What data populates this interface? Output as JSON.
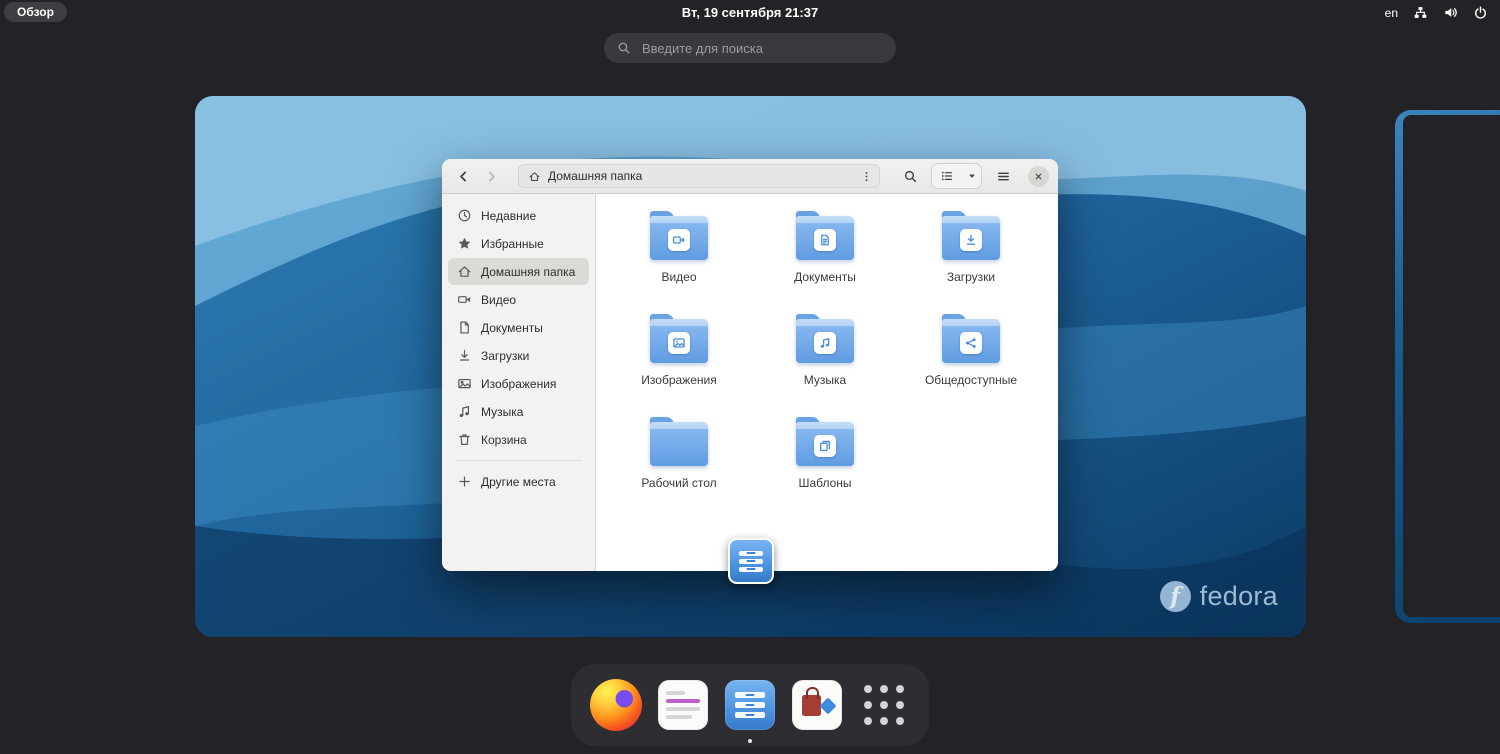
{
  "topbar": {
    "overview_label": "Обзор",
    "clock": "Вт, 19 сентября  21:37",
    "keyboard_layout": "en",
    "status_icons": [
      "network-icon",
      "volume-icon",
      "power-icon"
    ]
  },
  "search": {
    "placeholder": "Введите для поиска"
  },
  "window": {
    "pathbar_location": "Домашняя папка",
    "sidebar": [
      {
        "label": "Недавние",
        "icon": "recent-icon"
      },
      {
        "label": "Избранные",
        "icon": "starred-icon"
      },
      {
        "label": "Домашняя папка",
        "icon": "home-icon",
        "selected": true
      },
      {
        "label": "Видео",
        "icon": "videos-icon"
      },
      {
        "label": "Документы",
        "icon": "documents-icon"
      },
      {
        "label": "Загрузки",
        "icon": "downloads-icon"
      },
      {
        "label": "Изображения",
        "icon": "pictures-icon"
      },
      {
        "label": "Музыка",
        "icon": "music-icon"
      },
      {
        "label": "Корзина",
        "icon": "trash-icon"
      },
      {
        "label": "Другие места",
        "icon": "plus-icon"
      }
    ],
    "folders": [
      {
        "label": "Видео",
        "emblem": "video-emblem-icon"
      },
      {
        "label": "Документы",
        "emblem": "document-emblem-icon"
      },
      {
        "label": "Загрузки",
        "emblem": "download-emblem-icon"
      },
      {
        "label": "Изображения",
        "emblem": "image-emblem-icon"
      },
      {
        "label": "Музыка",
        "emblem": "music-emblem-icon"
      },
      {
        "label": "Общедоступные",
        "emblem": "share-emblem-icon"
      },
      {
        "label": "Рабочий стол",
        "emblem": "none"
      },
      {
        "label": "Шаблоны",
        "emblem": "templates-emblem-icon"
      }
    ]
  },
  "dash": {
    "apps": [
      {
        "icon": "firefox-icon",
        "running": false
      },
      {
        "icon": "calendar-icon",
        "running": false
      },
      {
        "icon": "files-icon",
        "running": true
      },
      {
        "icon": "software-icon",
        "running": false
      },
      {
        "icon": "app-grid-icon",
        "running": false
      }
    ]
  },
  "branding": {
    "logo_glyph": "f",
    "wordmark": "fedora"
  },
  "colors": {
    "accent": "#3584e4",
    "folder_blue": "#5f9ce1",
    "dash_bg": "#2d2d32",
    "overview_bg": "#232327",
    "wallpaper_light": "#79bce4",
    "wallpaper_dark": "#0b3a63"
  }
}
